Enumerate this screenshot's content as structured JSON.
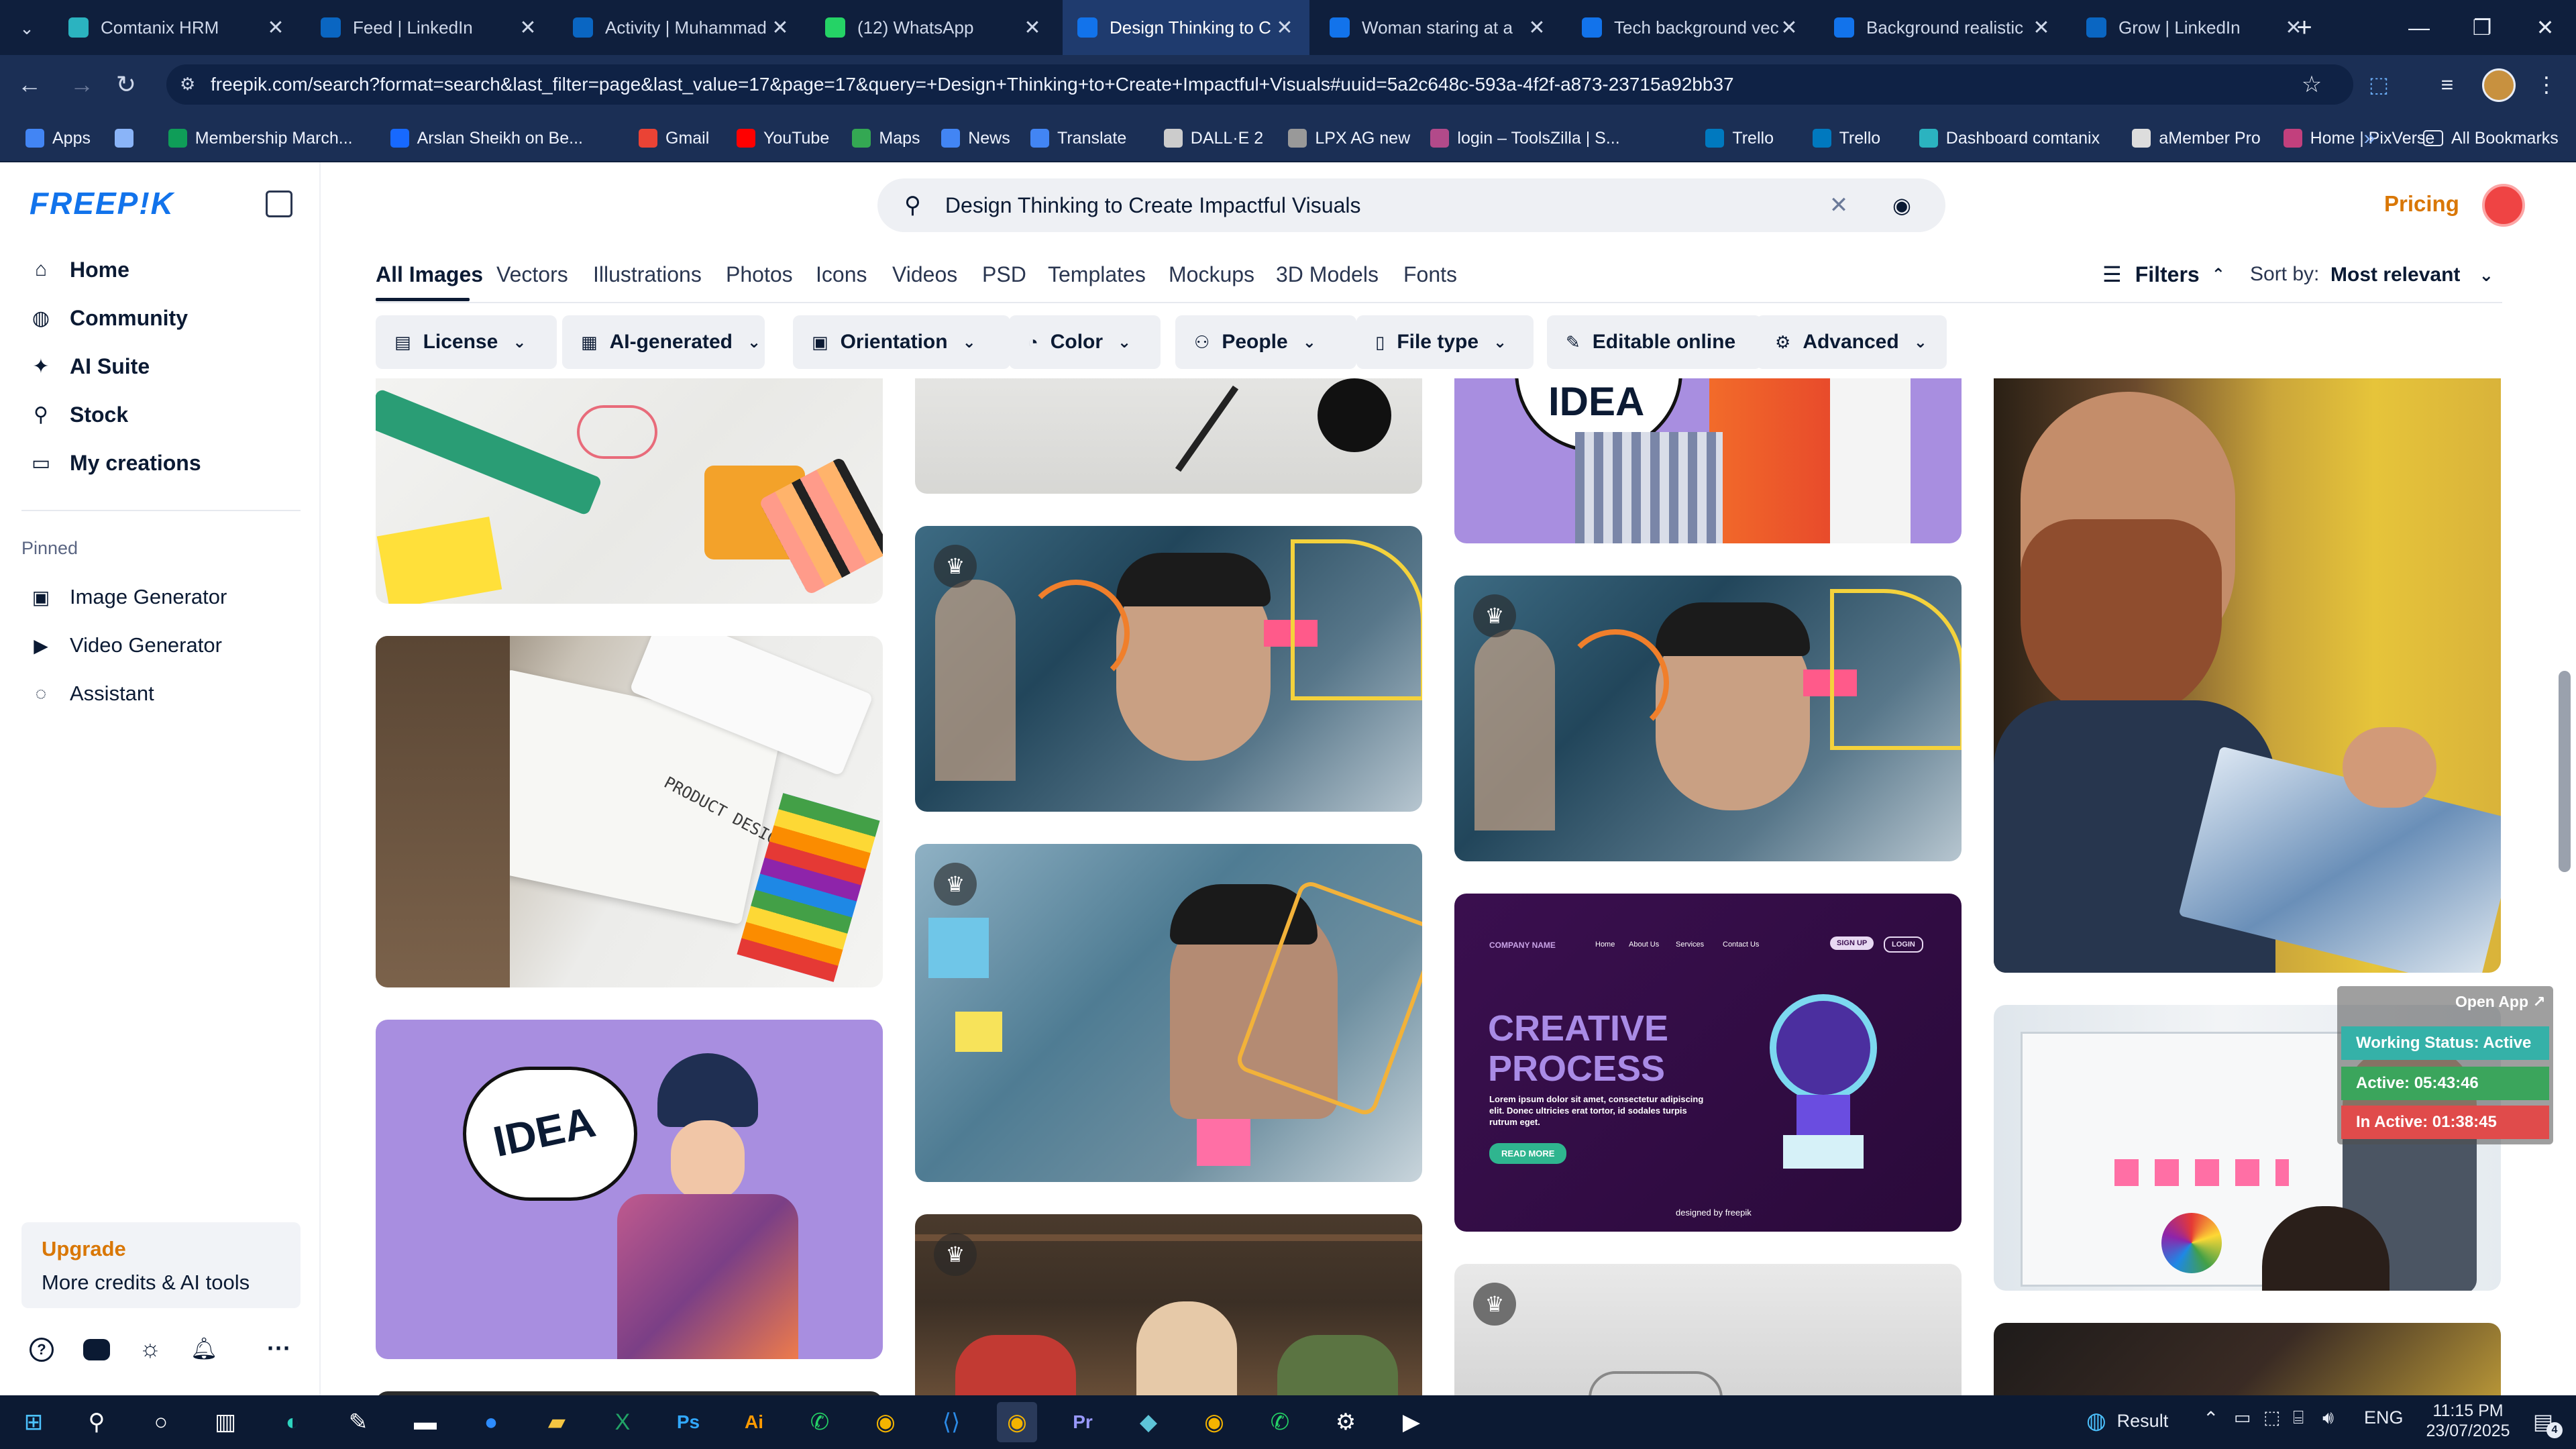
{
  "browser": {
    "tabs": [
      {
        "title": "Comtanix HRM",
        "icon": "comtanix-icon",
        "color": "#2bb3c0"
      },
      {
        "title": "Feed | LinkedIn",
        "icon": "linkedin-icon",
        "color": "#0a66c2"
      },
      {
        "title": "Activity | Muhammad",
        "icon": "linkedin-icon",
        "color": "#0a66c2"
      },
      {
        "title": "(12) WhatsApp",
        "icon": "whatsapp-icon",
        "color": "#25d366"
      },
      {
        "title": "Design Thinking to C",
        "icon": "freepik-icon",
        "color": "#1273eb"
      },
      {
        "title": "Woman staring at a",
        "icon": "freepik-icon",
        "color": "#1273eb"
      },
      {
        "title": "Tech background vec",
        "icon": "freepik-icon",
        "color": "#1273eb"
      },
      {
        "title": "Background realistic",
        "icon": "freepik-icon",
        "color": "#1273eb"
      },
      {
        "title": "Grow | LinkedIn",
        "icon": "linkedin-icon",
        "color": "#0a66c2"
      }
    ],
    "active_tab_index": 4,
    "url": "freepik.com/search?format=search&last_filter=page&last_value=17&page=17&query=+Design+Thinking+to+Create+Impactful+Visuals#uuid=5a2c648c-593a-4f2f-a873-23715a92bb37",
    "bookmarks": [
      {
        "label": "Apps",
        "icon": "apps-grid-icon",
        "color": "#4285f4"
      },
      {
        "label": "",
        "icon": "grid-icon",
        "color": "#8ab4f8"
      },
      {
        "label": "Membership March...",
        "icon": "sheets-icon",
        "color": "#0f9d58"
      },
      {
        "label": "Arslan Sheikh on Be...",
        "icon": "behance-icon",
        "color": "#1769ff"
      },
      {
        "label": "Gmail",
        "icon": "gmail-icon",
        "color": "#ea4335"
      },
      {
        "label": "YouTube",
        "icon": "youtube-icon",
        "color": "#ff0000"
      },
      {
        "label": "Maps",
        "icon": "maps-icon",
        "color": "#34a853"
      },
      {
        "label": "News",
        "icon": "news-icon",
        "color": "#4285f4"
      },
      {
        "label": "Translate",
        "icon": "translate-icon",
        "color": "#4285f4"
      },
      {
        "label": "DALL·E 2",
        "icon": "openai-icon",
        "color": "#cccccc"
      },
      {
        "label": "LPX AG new",
        "icon": "dash-icon",
        "color": "#999999"
      },
      {
        "label": "login – ToolsZilla | S...",
        "icon": "toolszilla-icon",
        "color": "#b24a8a"
      },
      {
        "label": "Trello",
        "icon": "trello-icon",
        "color": "#0079bf"
      },
      {
        "label": "Trello",
        "icon": "trello-icon",
        "color": "#0079bf"
      },
      {
        "label": "Dashboard comtanix",
        "icon": "comtanix-icon",
        "color": "#2bb3c0"
      },
      {
        "label": "aMember Pro",
        "icon": "amember-icon",
        "color": "#dddddd"
      },
      {
        "label": "Home | PixVerse",
        "icon": "pixverse-icon",
        "color": "#c2407d"
      }
    ],
    "all_bookmarks_label": "All Bookmarks"
  },
  "freepik": {
    "logo": "FREEP!K",
    "nav": [
      {
        "label": "Home",
        "icon": "home-icon"
      },
      {
        "label": "Community",
        "icon": "globe-icon"
      },
      {
        "label": "AI Suite",
        "icon": "sparkle-icon"
      },
      {
        "label": "Stock",
        "icon": "search-icon"
      },
      {
        "label": "My creations",
        "icon": "folder-icon"
      }
    ],
    "pinned_label": "Pinned",
    "pinned": [
      {
        "label": "Image Generator",
        "icon": "image-icon"
      },
      {
        "label": "Video Generator",
        "icon": "video-icon"
      },
      {
        "label": "Assistant",
        "icon": "chat-icon"
      }
    ],
    "upgrade": {
      "title": "Upgrade",
      "subtitle": "More credits & AI tools",
      "accent": "#d97706"
    },
    "search_query": "Design Thinking to Create Impactful Visuals",
    "pricing_label": "Pricing",
    "pricing_color": "#d97706",
    "categories": [
      "All Images",
      "Vectors",
      "Illustrations",
      "Photos",
      "Icons",
      "Videos",
      "PSD",
      "Templates",
      "Mockups",
      "3D Models",
      "Fonts"
    ],
    "active_category": "All Images",
    "filters_label": "Filters",
    "sort_label": "Sort by:",
    "sort_value": "Most relevant",
    "chips": [
      {
        "label": "License",
        "icon": "license-icon"
      },
      {
        "label": "AI-generated",
        "icon": "ai-icon"
      },
      {
        "label": "Orientation",
        "icon": "orientation-icon"
      },
      {
        "label": "Color",
        "icon": "palette-icon"
      },
      {
        "label": "People",
        "icon": "people-icon"
      },
      {
        "label": "File type",
        "icon": "file-icon"
      },
      {
        "label": "Editable online",
        "icon": "pen-icon"
      },
      {
        "label": "Advanced",
        "icon": "settings-icon"
      }
    ],
    "template_card": {
      "company": "COMPANY NAME",
      "nav": [
        "Home",
        "About Us",
        "Services",
        "Contact Us"
      ],
      "signup": "SIGN UP",
      "login": "LOGIN",
      "headline1": "CREATIVE",
      "headline2": "PROCESS",
      "body": "Lorem ipsum dolor sit amet, consectetur adipiscing elit. Donec ultricies erat tortor, id sodales turpis rutrum eget.",
      "cta": "READ MORE",
      "credit": "designed by freepik"
    },
    "idea_text": "IDEA",
    "product_design_text": "PRODUCT DESIGN"
  },
  "overlay_widget": {
    "open_app": "Open App ↗",
    "working_status": "Working Status: Active",
    "active": "Active: 05:43:46",
    "inactive": "In Active: 01:38:45"
  },
  "taskbar": {
    "result_label": "Result",
    "language": "ENG",
    "time": "11:15 PM",
    "date": "23/07/2025",
    "notification_count": "4"
  }
}
